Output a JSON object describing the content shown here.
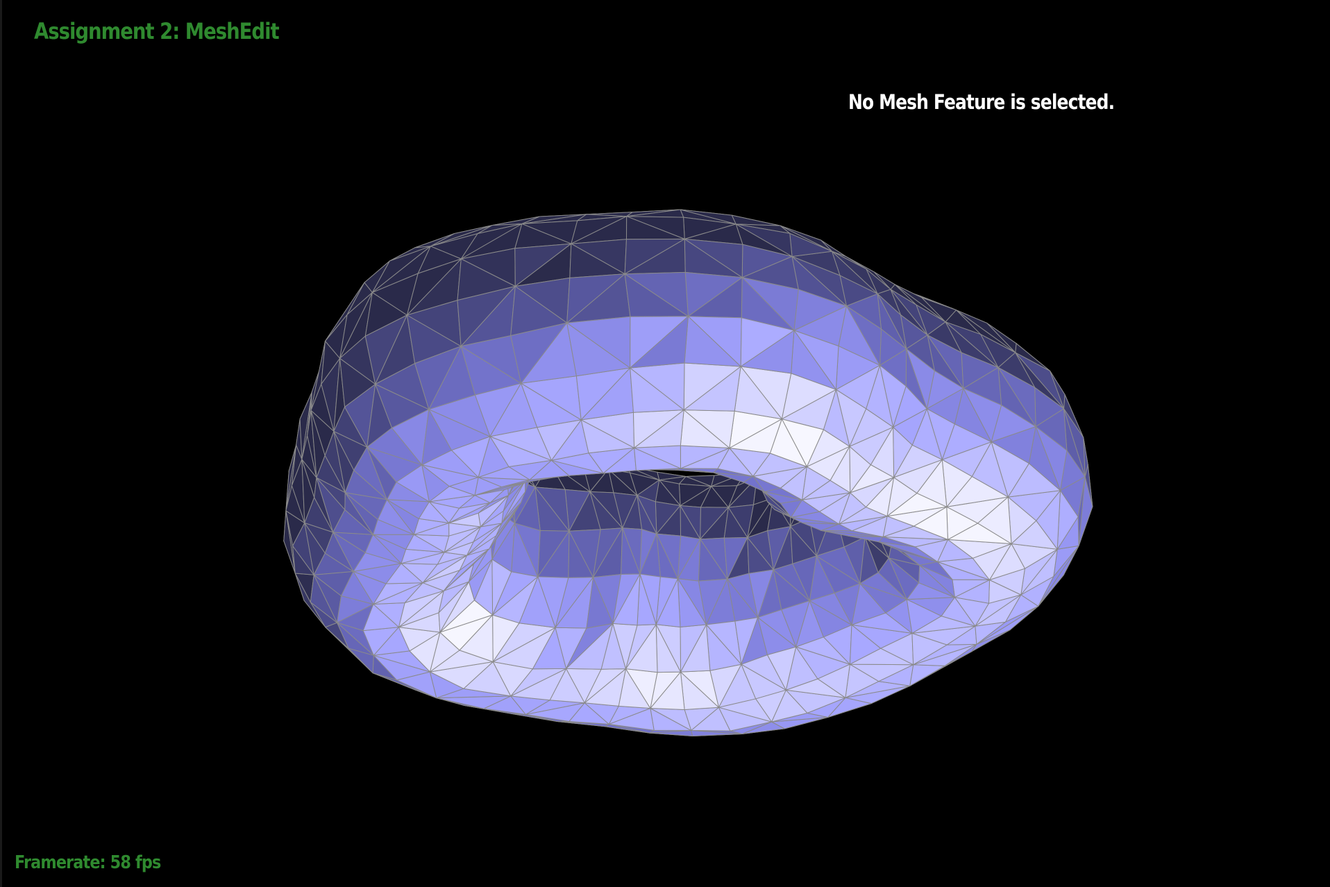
{
  "app": {
    "title": "Assignment 2: MeshEdit",
    "title_color": "#2f8a2f"
  },
  "status": {
    "selection_text": "No Mesh Feature is selected.",
    "color": "#ffffff"
  },
  "footer": {
    "framerate_text": "Framerate: 58 fps",
    "color": "#2f8a2f"
  },
  "scene": {
    "background": "#000000",
    "mesh_type": "torus",
    "mesh_base_color": "#8c8cff",
    "mesh_highlight_color": "#ffffff",
    "mesh_shadow_color": "#2a2a4a",
    "wireframe_color": "#8a8a8a"
  }
}
